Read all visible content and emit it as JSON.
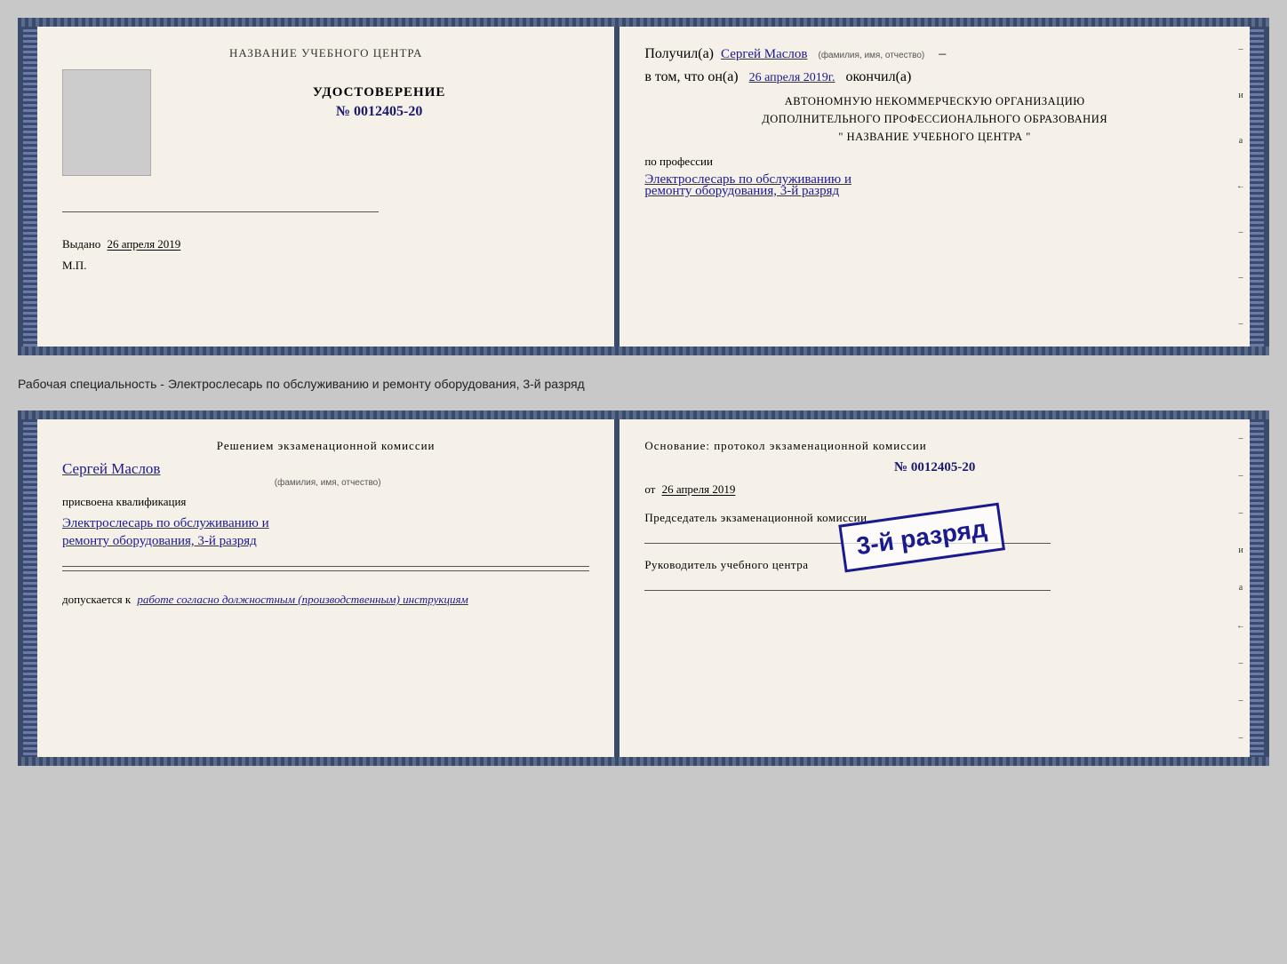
{
  "cert1": {
    "left": {
      "title": "НАЗВАНИЕ УЧЕБНОГО ЦЕНТРА",
      "udostoverenie_label": "УДОСТОВЕРЕНИЕ",
      "number": "№ 0012405-20",
      "vydano_label": "Выдано",
      "vydano_date": "26 апреля 2019",
      "mp_label": "М.П."
    },
    "right": {
      "poluchil_label": "Получил(а)",
      "recipient_name": "Сергей Маслов",
      "fio_hint": "(фамилия, имя, отчество)",
      "dash": "–",
      "vtom_label": "в том, что он(а)",
      "date_value": "26 апреля 2019г.",
      "okончил_label": "окончил(а)",
      "org_line1": "АВТОНОМНУЮ НЕКОММЕРЧЕСКУЮ ОРГАНИЗАЦИЮ",
      "org_line2": "ДОПОЛНИТЕЛЬНОГО ПРОФЕССИОНАЛЬНОГО ОБРАЗОВАНИЯ",
      "org_line3": "\"  НАЗВАНИЕ УЧЕБНОГО ЦЕНТРА  \"",
      "po_professii_label": "по профессии",
      "profession_line1": "Электрослесарь по обслуживанию и",
      "profession_line2": "ремонту оборудования, 3-й разряд"
    }
  },
  "between_label": "Рабочая специальность - Электрослесарь по обслуживанию и ремонту оборудования, 3-й разряд",
  "cert2": {
    "left": {
      "resheniyem_label": "Решением экзаменационной комиссии",
      "name": "Сергей Маслов",
      "fio_hint": "(фамилия, имя, отчество)",
      "prisvoena_label": "присвоена квалификация",
      "qualification_line1": "Электрослесарь по обслуживанию и",
      "qualification_line2": "ремонту оборудования, 3-й разряд",
      "dopuskaetsya_label": "допускается к",
      "dopusk_text": "работе согласно должностным (производственным) инструкциям"
    },
    "right": {
      "osnovanie_label": "Основание: протокол экзаменационной комиссии",
      "number": "№  0012405-20",
      "ot_label": "от",
      "ot_date": "26 апреля 2019",
      "predsedatel_label": "Председатель экзаменационной комиссии",
      "rukovoditel_label": "Руководитель учебного центра"
    },
    "stamp_text": "3-й разряд"
  }
}
